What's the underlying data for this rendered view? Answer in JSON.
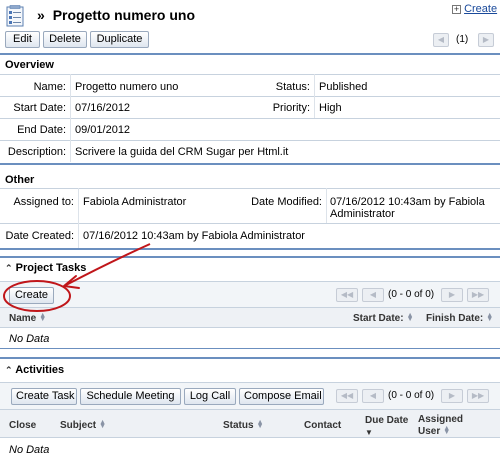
{
  "header": {
    "title": "Progetto numero uno",
    "title_prefix": "»",
    "create_link": "Create",
    "paging": "(1)"
  },
  "toolbar": {
    "edit": "Edit",
    "delete": "Delete",
    "duplicate": "Duplicate"
  },
  "overview": {
    "title": "Overview",
    "name_label": "Name:",
    "name_value": "Progetto numero uno",
    "status_label": "Status:",
    "status_value": "Published",
    "start_label": "Start Date:",
    "start_value": "07/16/2012",
    "priority_label": "Priority:",
    "priority_value": "High",
    "end_label": "End Date:",
    "end_value": "09/01/2012",
    "desc_label": "Description:",
    "desc_value": "Scrivere la guida del CRM Sugar per Html.it"
  },
  "other": {
    "title": "Other",
    "assigned_label": "Assigned to:",
    "assigned_value": "Fabiola Administrator",
    "modified_label": "Date Modified:",
    "modified_value_1": "07/16/2012 10:43am by Fabiola",
    "modified_value_2": "Administrator",
    "created_label": "Date Created:",
    "created_value": "07/16/2012 10:43am by Fabiola Administrator"
  },
  "project_tasks": {
    "title": "Project Tasks",
    "create": "Create",
    "paging": "(0 - 0 of 0)",
    "columns": [
      "Name",
      "Start Date:",
      "Finish Date:"
    ],
    "no_data": "No Data"
  },
  "activities": {
    "title": "Activities",
    "buttons": [
      "Create Task",
      "Schedule Meeting",
      "Log Call",
      "Compose Email"
    ],
    "paging": "(0 - 0 of 0)",
    "columns": [
      "Close",
      "Subject",
      "Status",
      "Contact",
      "Due Date",
      "Assigned",
      "User"
    ],
    "no_data": "No Data"
  },
  "colors": {
    "accent_line": "#6b8fbf",
    "annotation": "#c0161a",
    "link": "#1a4a9b"
  }
}
